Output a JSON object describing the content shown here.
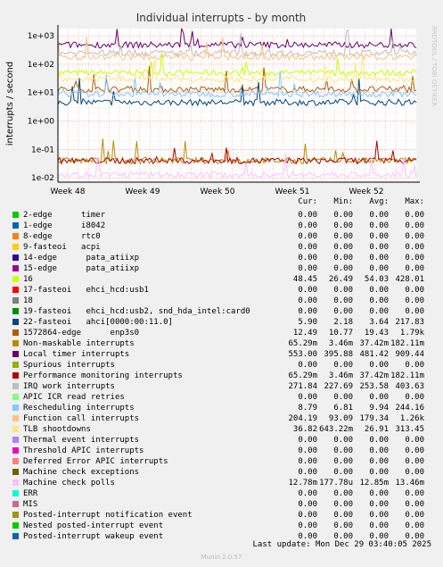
{
  "chart_data": {
    "type": "line",
    "title": "Individual interrupts - by month",
    "ylabel": "interrupts / second",
    "yscale": "log",
    "ylim": [
      0.007,
      1800
    ],
    "ytick_labels": [
      "1e-02",
      "1e-01",
      "1e+00",
      "1e+01",
      "1e+02",
      "1e+03"
    ],
    "ytick_values": [
      0.01,
      0.1,
      1,
      10,
      100,
      1000
    ],
    "xtick_labels": [
      "Week 48",
      "Week 49",
      "Week 50",
      "Week 51",
      "Week 52"
    ],
    "grid": true,
    "watermark": "RRDTOOL / TOBI OETIKER",
    "legend_headers": [
      "Cur:",
      "Min:",
      "Avg:",
      "Max:"
    ],
    "series": [
      {
        "name": "2-edge      timer",
        "color": "#00cc00",
        "cur": "0.00",
        "min": "0.00",
        "avg": "0.00",
        "max": "0.00"
      },
      {
        "name": "1-edge      i8042",
        "color": "#0066b3",
        "cur": "0.00",
        "min": "0.00",
        "avg": "0.00",
        "max": "0.00"
      },
      {
        "name": "8-edge      rtc0",
        "color": "#ff8000",
        "cur": "0.00",
        "min": "0.00",
        "avg": "0.00",
        "max": "0.00"
      },
      {
        "name": "9-fasteoi   acpi",
        "color": "#ffcc00",
        "cur": "0.00",
        "min": "0.00",
        "avg": "0.00",
        "max": "0.00"
      },
      {
        "name": "14-edge      pata_atiixp",
        "color": "#330099",
        "cur": "0.00",
        "min": "0.00",
        "avg": "0.00",
        "max": "0.00"
      },
      {
        "name": "15-edge      pata_atiixp",
        "color": "#990099",
        "cur": "0.00",
        "min": "0.00",
        "avg": "0.00",
        "max": "0.00"
      },
      {
        "name": "16",
        "color": "#ccff00",
        "cur": "48.45",
        "min": "26.49",
        "avg": "54.03",
        "max": "428.01",
        "level": 50
      },
      {
        "name": "17-fasteoi   ehci_hcd:usb1",
        "color": "#ff0000",
        "cur": "0.00",
        "min": "0.00",
        "avg": "0.00",
        "max": "0.00"
      },
      {
        "name": "18",
        "color": "#808080",
        "cur": "0.00",
        "min": "0.00",
        "avg": "0.00",
        "max": "0.00"
      },
      {
        "name": "19-fasteoi   ehci_hcd:usb2, snd_hda_intel:card0",
        "color": "#008f00",
        "cur": "0.00",
        "min": "0.00",
        "avg": "0.00",
        "max": "0.00"
      },
      {
        "name": "22-fasteoi   ahci[0000:00:11.0]",
        "color": "#00487d",
        "cur": "5.90",
        "min": "2.18",
        "avg": "3.64",
        "max": "217.83",
        "level": 4.5
      },
      {
        "name": "1572864-edge      enp3s0",
        "color": "#b35a00",
        "cur": "12.49",
        "min": "10.77",
        "avg": "19.43",
        "max": "1.79k",
        "level": 13
      },
      {
        "name": "Non-maskable interrupts",
        "color": "#b38f00",
        "cur": "65.29m",
        "min": "3.46m",
        "avg": "37.42m",
        "max": "182.11m",
        "level": 0.04
      },
      {
        "name": "Local timer interrupts",
        "color": "#6b006b",
        "cur": "553.00",
        "min": "395.88",
        "avg": "481.42",
        "max": "909.44",
        "level": 480
      },
      {
        "name": "Spurious interrupts",
        "color": "#8fb300",
        "cur": "0.00",
        "min": "0.00",
        "avg": "0.00",
        "max": "0.00"
      },
      {
        "name": "Performance monitoring interrupts",
        "color": "#b30000",
        "cur": "65.29m",
        "min": "3.46m",
        "avg": "37.42m",
        "max": "182.11m",
        "level": 0.04
      },
      {
        "name": "IRQ work interrupts",
        "color": "#bebebe",
        "cur": "271.84",
        "min": "227.69",
        "avg": "253.58",
        "max": "403.63",
        "level": 250
      },
      {
        "name": "APIC ICR read retries",
        "color": "#80ff80",
        "cur": "0.00",
        "min": "0.00",
        "avg": "0.00",
        "max": "0.00"
      },
      {
        "name": "Rescheduling interrupts",
        "color": "#80c9ff",
        "cur": "8.79",
        "min": "6.81",
        "avg": "9.94",
        "max": "244.16",
        "level": 9
      },
      {
        "name": "Function call interrupts",
        "color": "#ffc080",
        "cur": "204.19",
        "min": "93.09",
        "avg": "179.34",
        "max": "1.26k",
        "level": 180
      },
      {
        "name": "TLB shootdowns",
        "color": "#ffe680",
        "cur": "36.82",
        "min": "643.22m",
        "avg": "26.91",
        "max": "313.45",
        "level": 30
      },
      {
        "name": "Thermal event interrupts",
        "color": "#aa80ff",
        "cur": "0.00",
        "min": "0.00",
        "avg": "0.00",
        "max": "0.00"
      },
      {
        "name": "Threshold APIC interrupts",
        "color": "#ee00cc",
        "cur": "0.00",
        "min": "0.00",
        "avg": "0.00",
        "max": "0.00"
      },
      {
        "name": "Deferred Error APIC interrupts",
        "color": "#ff8080",
        "cur": "0.00",
        "min": "0.00",
        "avg": "0.00",
        "max": "0.00"
      },
      {
        "name": "Machine check exceptions",
        "color": "#666600",
        "cur": "0.00",
        "min": "0.00",
        "avg": "0.00",
        "max": "0.00"
      },
      {
        "name": "Machine check polls",
        "color": "#ffbfff",
        "cur": "12.78m",
        "min": "177.78u",
        "avg": "12.85m",
        "max": "13.46m",
        "level": 0.0128
      },
      {
        "name": "ERR",
        "color": "#00ffcc",
        "cur": "0.00",
        "min": "0.00",
        "avg": "0.00",
        "max": "0.00"
      },
      {
        "name": "MIS",
        "color": "#cc6699",
        "cur": "0.00",
        "min": "0.00",
        "avg": "0.00",
        "max": "0.00"
      },
      {
        "name": "Posted-interrupt notification event",
        "color": "#999900",
        "cur": "0.00",
        "min": "0.00",
        "avg": "0.00",
        "max": "0.00"
      },
      {
        "name": "Nested posted-interrupt event",
        "color": "#00cc00",
        "cur": "0.00",
        "min": "0.00",
        "avg": "0.00",
        "max": "0.00"
      },
      {
        "name": "Posted-interrupt wakeup event",
        "color": "#0066b3",
        "cur": "0.00",
        "min": "0.00",
        "avg": "0.00",
        "max": "0.00"
      }
    ]
  },
  "last_update": "Last update: Mon Dec 29 03:40:05 2025",
  "footer": "Munin 2.0.57"
}
